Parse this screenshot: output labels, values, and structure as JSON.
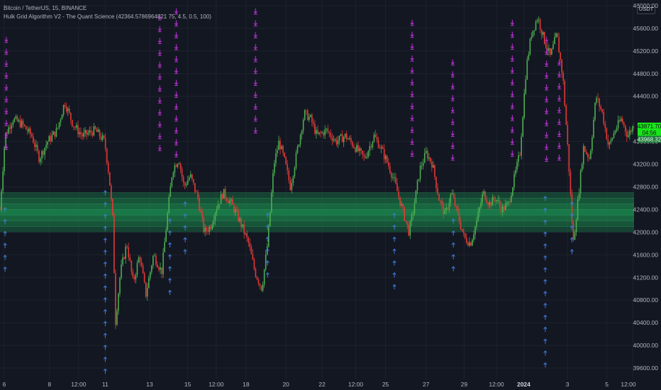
{
  "header": {
    "symbol_line": "Bitcoin / TetherUS, 15, BINANCE",
    "indicator_line": "Hulk Grid Algorithm V2 - The Quant Science (42364.5786964821 75, 4.5, 0.5, 100)",
    "currency_badge": "USDT"
  },
  "colors": {
    "background": "#131722",
    "grid": "#1e222d",
    "candle_up": "#4caf50",
    "candle_down": "#e53935",
    "sell_marker": "#c034d8",
    "buy_marker": "#3f7bd8",
    "grid_zone": "#1b8a4d",
    "price_label_bg": "#19e619"
  },
  "chart_data": {
    "type": "candlestick",
    "title": "Bitcoin / TetherUS, 15, BINANCE",
    "ylim": [
      39400,
      46100
    ],
    "y_ticks": [
      "46000.00",
      "45600.00",
      "45200.00",
      "44800.00",
      "44400.00",
      "43600.00",
      "43200.00",
      "42800.00",
      "42400.00",
      "42000.00",
      "41600.00",
      "41200.00",
      "40800.00",
      "40400.00",
      "40000.00",
      "39600.00"
    ],
    "x_ticks": [
      {
        "label": "6",
        "t": 0.0065,
        "bold": false
      },
      {
        "label": "8",
        "t": 0.078,
        "bold": false
      },
      {
        "label": "12:00",
        "t": 0.124,
        "bold": false
      },
      {
        "label": "11",
        "t": 0.166,
        "bold": false
      },
      {
        "label": "13",
        "t": 0.236,
        "bold": false
      },
      {
        "label": "15",
        "t": 0.296,
        "bold": false
      },
      {
        "label": "12:00",
        "t": 0.341,
        "bold": false
      },
      {
        "label": "18",
        "t": 0.388,
        "bold": false
      },
      {
        "label": "20",
        "t": 0.451,
        "bold": false
      },
      {
        "label": "22",
        "t": 0.508,
        "bold": false
      },
      {
        "label": "12:00",
        "t": 0.561,
        "bold": false
      },
      {
        "label": "25",
        "t": 0.608,
        "bold": false
      },
      {
        "label": "27",
        "t": 0.672,
        "bold": false
      },
      {
        "label": "29",
        "t": 0.732,
        "bold": false
      },
      {
        "label": "12:00",
        "t": 0.783,
        "bold": false
      },
      {
        "label": "2024",
        "t": 0.826,
        "bold": true
      },
      {
        "label": "3",
        "t": 0.895,
        "bold": false
      },
      {
        "label": "5",
        "t": 0.957,
        "bold": false
      },
      {
        "label": "12:00",
        "t": 0.998,
        "bold": false
      }
    ],
    "grid_levels": [
      42000,
      42100,
      42200,
      42300,
      42400,
      42500,
      42600,
      42700
    ],
    "price_path": [
      [
        0.0,
        42400
      ],
      [
        0.008,
        43700
      ],
      [
        0.02,
        44000
      ],
      [
        0.035,
        43900
      ],
      [
        0.05,
        43700
      ],
      [
        0.062,
        43300
      ],
      [
        0.075,
        43600
      ],
      [
        0.09,
        43800
      ],
      [
        0.102,
        44300
      ],
      [
        0.115,
        43900
      ],
      [
        0.13,
        43700
      ],
      [
        0.15,
        43800
      ],
      [
        0.165,
        43600
      ],
      [
        0.172,
        43000
      ],
      [
        0.178,
        42200
      ],
      [
        0.182,
        40400
      ],
      [
        0.19,
        41300
      ],
      [
        0.2,
        41800
      ],
      [
        0.21,
        41100
      ],
      [
        0.22,
        41600
      ],
      [
        0.23,
        40900
      ],
      [
        0.242,
        41600
      ],
      [
        0.255,
        41300
      ],
      [
        0.265,
        42400
      ],
      [
        0.272,
        43100
      ],
      [
        0.282,
        43300
      ],
      [
        0.29,
        42800
      ],
      [
        0.3,
        43000
      ],
      [
        0.312,
        42600
      ],
      [
        0.322,
        42000
      ],
      [
        0.332,
        42100
      ],
      [
        0.34,
        42400
      ],
      [
        0.352,
        42700
      ],
      [
        0.365,
        42500
      ],
      [
        0.378,
        42200
      ],
      [
        0.392,
        41800
      ],
      [
        0.402,
        41300
      ],
      [
        0.413,
        41000
      ],
      [
        0.422,
        41800
      ],
      [
        0.432,
        43200
      ],
      [
        0.44,
        43600
      ],
      [
        0.448,
        43300
      ],
      [
        0.458,
        42800
      ],
      [
        0.468,
        43400
      ],
      [
        0.48,
        44100
      ],
      [
        0.49,
        44000
      ],
      [
        0.5,
        43700
      ],
      [
        0.515,
        43800
      ],
      [
        0.53,
        43600
      ],
      [
        0.545,
        43700
      ],
      [
        0.56,
        43500
      ],
      [
        0.575,
        43300
      ],
      [
        0.59,
        43700
      ],
      [
        0.6,
        43500
      ],
      [
        0.612,
        43200
      ],
      [
        0.622,
        42900
      ],
      [
        0.632,
        42500
      ],
      [
        0.645,
        42000
      ],
      [
        0.652,
        42400
      ],
      [
        0.662,
        43100
      ],
      [
        0.672,
        43400
      ],
      [
        0.682,
        43200
      ],
      [
        0.692,
        42600
      ],
      [
        0.702,
        42300
      ],
      [
        0.712,
        42700
      ],
      [
        0.722,
        42300
      ],
      [
        0.732,
        41900
      ],
      [
        0.742,
        41800
      ],
      [
        0.752,
        42200
      ],
      [
        0.762,
        42700
      ],
      [
        0.772,
        42500
      ],
      [
        0.782,
        42600
      ],
      [
        0.792,
        42400
      ],
      [
        0.802,
        42500
      ],
      [
        0.812,
        43000
      ],
      [
        0.82,
        43400
      ],
      [
        0.83,
        44900
      ],
      [
        0.838,
        45500
      ],
      [
        0.848,
        45800
      ],
      [
        0.858,
        45400
      ],
      [
        0.868,
        45100
      ],
      [
        0.878,
        45500
      ],
      [
        0.888,
        44700
      ],
      [
        0.896,
        43400
      ],
      [
        0.904,
        41800
      ],
      [
        0.912,
        42600
      ],
      [
        0.92,
        43500
      ],
      [
        0.93,
        43300
      ],
      [
        0.94,
        44400
      ],
      [
        0.95,
        44100
      ],
      [
        0.96,
        43500
      ],
      [
        0.97,
        43800
      ],
      [
        0.98,
        44000
      ],
      [
        0.99,
        43700
      ],
      [
        1.0,
        43900
      ]
    ],
    "sell_markers": [
      {
        "t": 0.01,
        "top": 45400,
        "bottom": 43500
      },
      {
        "t": 0.252,
        "top": 45800,
        "bottom": 43300
      },
      {
        "t": 0.278,
        "top": 45900,
        "bottom": 43300
      },
      {
        "t": 0.403,
        "top": 45900,
        "bottom": 43600
      },
      {
        "t": 0.65,
        "top": 45700,
        "bottom": 43200
      },
      {
        "t": 0.714,
        "top": 45000,
        "bottom": 43300
      },
      {
        "t": 0.808,
        "top": 45700,
        "bottom": 43300
      },
      {
        "t": 0.862,
        "top": 45400,
        "bottom": 43100
      },
      {
        "t": 0.882,
        "top": 45000,
        "bottom": 43300
      }
    ],
    "buy_markers": [
      {
        "t": 0.008,
        "top": 42400,
        "bottom": 41200
      },
      {
        "t": 0.166,
        "top": 42700,
        "bottom": 39500
      },
      {
        "t": 0.268,
        "top": 42200,
        "bottom": 40900
      },
      {
        "t": 0.292,
        "top": 42500,
        "bottom": 41600
      },
      {
        "t": 0.422,
        "top": 42300,
        "bottom": 41200
      },
      {
        "t": 0.622,
        "top": 42300,
        "bottom": 41000
      },
      {
        "t": 0.715,
        "top": 42200,
        "bottom": 41300
      },
      {
        "t": 0.86,
        "top": 42600,
        "bottom": 39500
      },
      {
        "t": 0.902,
        "top": 42500,
        "bottom": 41500
      }
    ],
    "price_labels": [
      {
        "value": "43871.70",
        "y": 43871.7,
        "bg": "#19e619",
        "fg": "#0c0e14"
      },
      {
        "value": "04:56",
        "y": 43760,
        "bg": "#19e619",
        "fg": "#0c0e14"
      },
      {
        "value": "43968.32",
        "y": 43640,
        "bg": "#1e7c3a",
        "fg": "#e8f5e9"
      }
    ]
  }
}
